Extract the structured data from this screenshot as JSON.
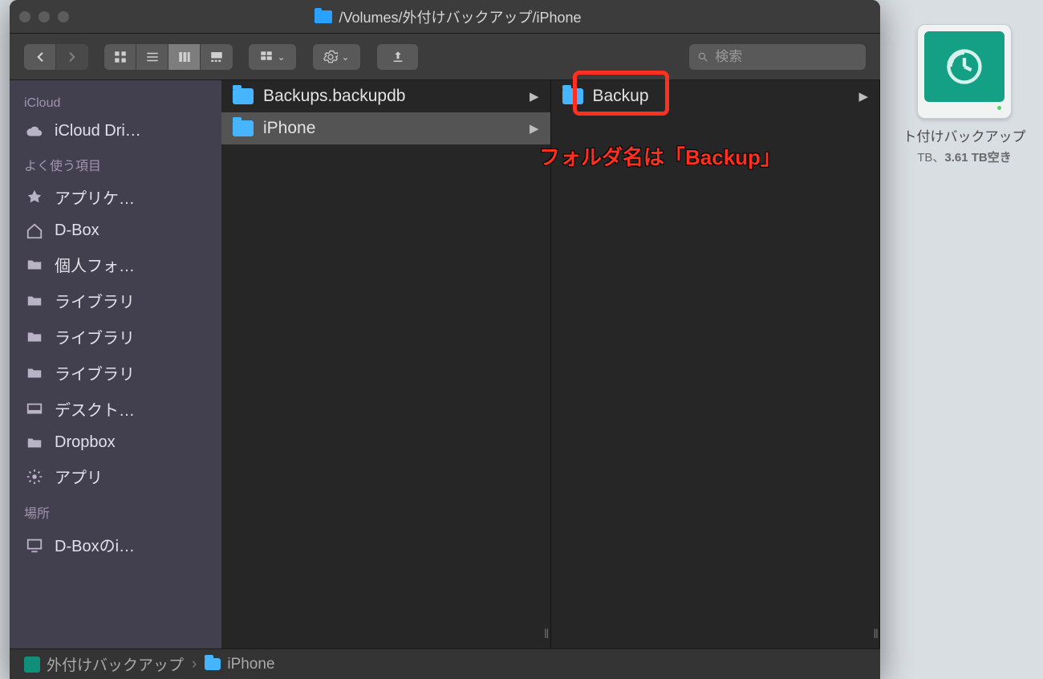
{
  "window": {
    "path_title": "/Volumes/外付けバックアップ/iPhone"
  },
  "search": {
    "placeholder": "検索"
  },
  "sidebar": {
    "group_icloud": "iCloud",
    "group_fav": "よく使う項目",
    "group_loc": "場所",
    "items": {
      "icloud_drive": "iCloud Dri…",
      "applications": "アプリケ…",
      "dbox": "D-Box",
      "personal": "個人フォ…",
      "library1": "ライブラリ",
      "library2": "ライブラリ",
      "library3": "ライブラリ",
      "desktop": "デスクト…",
      "dropbox": "Dropbox",
      "apps": "アプリ",
      "dbox_loc": "D-Boxのi…"
    }
  },
  "columns": {
    "col1": [
      {
        "label": "Backups.backupdb",
        "folder": true,
        "has_children": true,
        "selected": false
      },
      {
        "label": "iPhone",
        "folder": true,
        "has_children": true,
        "selected": true
      }
    ],
    "col2": [
      {
        "label": "Backup",
        "folder": true,
        "has_children": true,
        "selected": false
      }
    ]
  },
  "pathbar": {
    "seg1": "外付けバックアップ",
    "seg2": "iPhone"
  },
  "annotation": {
    "text": "フォルダ名は「Backup」"
  },
  "desktop_drive": {
    "label": "ト付けバックアップ",
    "info_prefix": "TB、",
    "info_bold": "3.61 TB空き"
  }
}
